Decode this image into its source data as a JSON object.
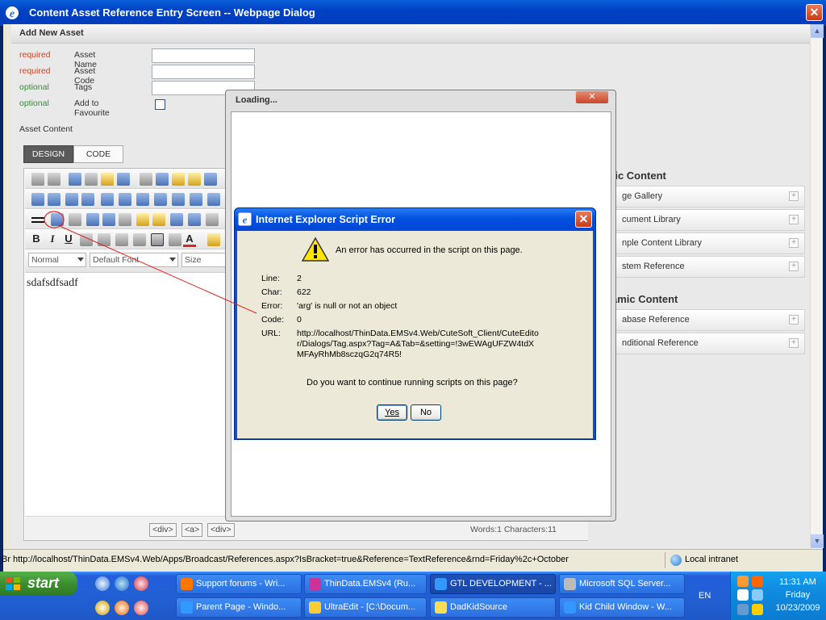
{
  "window": {
    "title": "Content Asset Reference Entry Screen -- Webpage Dialog",
    "close_glyph": "✕"
  },
  "page": {
    "header": "Add New Asset",
    "fields": [
      {
        "status": "required",
        "label": "Asset Name"
      },
      {
        "status": "required",
        "label": "Asset Code"
      },
      {
        "status": "optional",
        "label": "Tags"
      },
      {
        "status": "optional",
        "label": "Add to Favourite"
      }
    ],
    "asset_content_label": "Asset Content",
    "tab_design": "DESIGN",
    "tab_code": "CODE"
  },
  "editor": {
    "format_select": "Normal",
    "font_select": "Default Font",
    "size_select": "Size",
    "content": "sdafsdfsadf",
    "tag_div1": "<div>",
    "tag_a": "<a>",
    "tag_div2": "<div>",
    "word_count": "Words:1 Characters:11",
    "bold": "B",
    "italic": "I",
    "underline": "U",
    "font_color": "A"
  },
  "side": {
    "static_head": "tic Content",
    "static_items": [
      "ge Gallery",
      "cument Library",
      "nple Content Library",
      "stem Reference"
    ],
    "dynamic_head": "amic Content",
    "dynamic_items": [
      "abase Reference",
      "nditional Reference"
    ],
    "plus": "+"
  },
  "status_bar": {
    "url": "http://localhost/ThinData.EMSv4.Web/Apps/Broadcast/References.aspx?IsBracket=true&Reference=TextReference&rnd=Friday%2c+October",
    "zone": "Local intranet",
    "left_fragment": "Br"
  },
  "loading_window": {
    "title": "Loading...",
    "close_glyph": "✕"
  },
  "error_dialog": {
    "title": "Internet Explorer Script Error",
    "message": "An error has occurred in the script on this page.",
    "line_label": "Line:",
    "line_value": "2",
    "char_label": "Char:",
    "char_value": "622",
    "error_label": "Error:",
    "error_value": "'arg' is null or not an object",
    "code_label": "Code:",
    "code_value": "0",
    "url_label": "URL:",
    "url_value": "http://localhost/ThinData.EMSv4.Web/CuteSoft_Client/CuteEditor/Dialogs/Tag.aspx?Tag=A&Tab=&setting=!3wEWAgUFZW4tdXMFAyRhMb8sczqG2q74R5!",
    "question": "Do you want to continue running scripts on this page?",
    "yes": "Yes",
    "no": "No",
    "close_glyph": "✕"
  },
  "taskbar": {
    "start": "start",
    "tasks_row1": [
      "Support forums - Wri...",
      "ThinData.EMSv4 (Ru...",
      "GTL DEVELOPMENT - ...",
      "Microsoft SQL Server..."
    ],
    "tasks_row2": [
      "Parent Page - Windo...",
      "UltraEdit - [C:\\Docum...",
      "DadKidSource",
      "Kid Child Window - W..."
    ],
    "lang": "EN",
    "time": "11:31 AM",
    "day": "Friday",
    "date": "10/23/2009"
  },
  "colors": {
    "required": "#cc4422",
    "optional": "#3a8a3a",
    "xp_blue": "#0a4fd7",
    "annotation": "#e02020"
  }
}
